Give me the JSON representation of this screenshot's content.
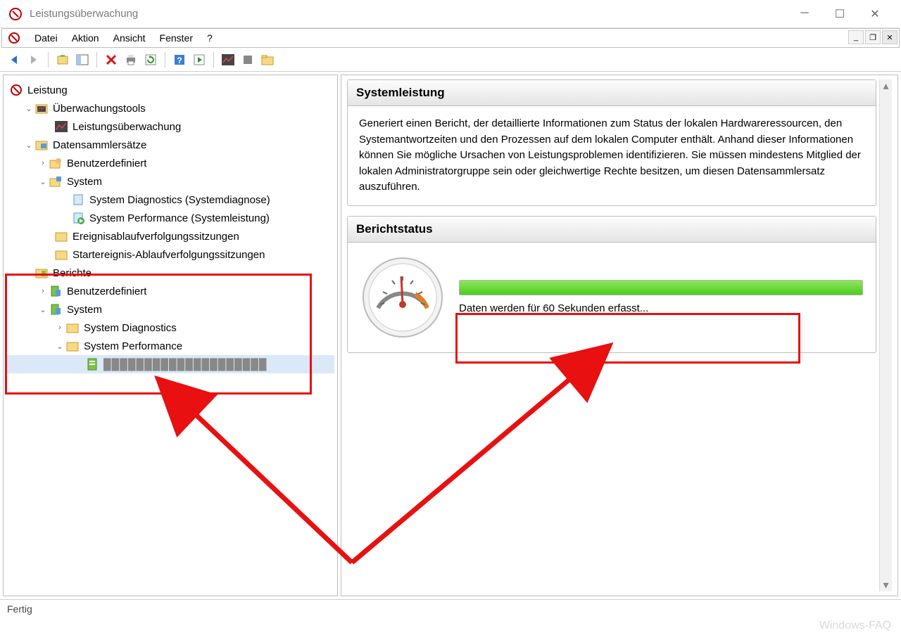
{
  "window": {
    "title": "Leistungsüberwachung"
  },
  "menu": {
    "datei": "Datei",
    "aktion": "Aktion",
    "ansicht": "Ansicht",
    "fenster": "Fenster",
    "help": "?"
  },
  "tree": {
    "root": "Leistung",
    "monitoring_tools": "Überwachungstools",
    "perfmon": "Leistungsüberwachung",
    "data_collector_sets": "Datensammlersätze",
    "user_defined": "Benutzerdefiniert",
    "system": "System",
    "sys_diag": "System Diagnostics (Systemdiagnose)",
    "sys_perf": "System Performance (Systemleistung)",
    "event_trace": "Ereignisablaufverfolgungssitzungen",
    "startup_trace": "Startereignis-Ablaufverfolgungssitzungen",
    "reports": "Berichte",
    "reports_user": "Benutzerdefiniert",
    "reports_system": "System",
    "reports_sys_diag": "System Diagnostics",
    "reports_sys_perf": "System Performance",
    "report_item": "████████████████████"
  },
  "content": {
    "section1_title": "Systemleistung",
    "section1_text": "Generiert einen Bericht, der detaillierte Informationen zum Status der lokalen Hardwareressourcen, den Systemantwortzeiten und den Prozessen auf dem lokalen Computer enthält. Anhand dieser Informationen können Sie mögliche Ursachen von Leistungsproblemen identifizieren. Sie müssen mindestens Mitglied der lokalen Administratorgruppe sein oder gleichwertige Rechte besitzen, um diesen Datensammlersatz auszuführen.",
    "section2_title": "Berichtstatus",
    "progress_text": "Daten werden für 60 Sekunden erfasst..."
  },
  "statusbar": {
    "text": "Fertig",
    "watermark": "Windows-FAQ"
  }
}
